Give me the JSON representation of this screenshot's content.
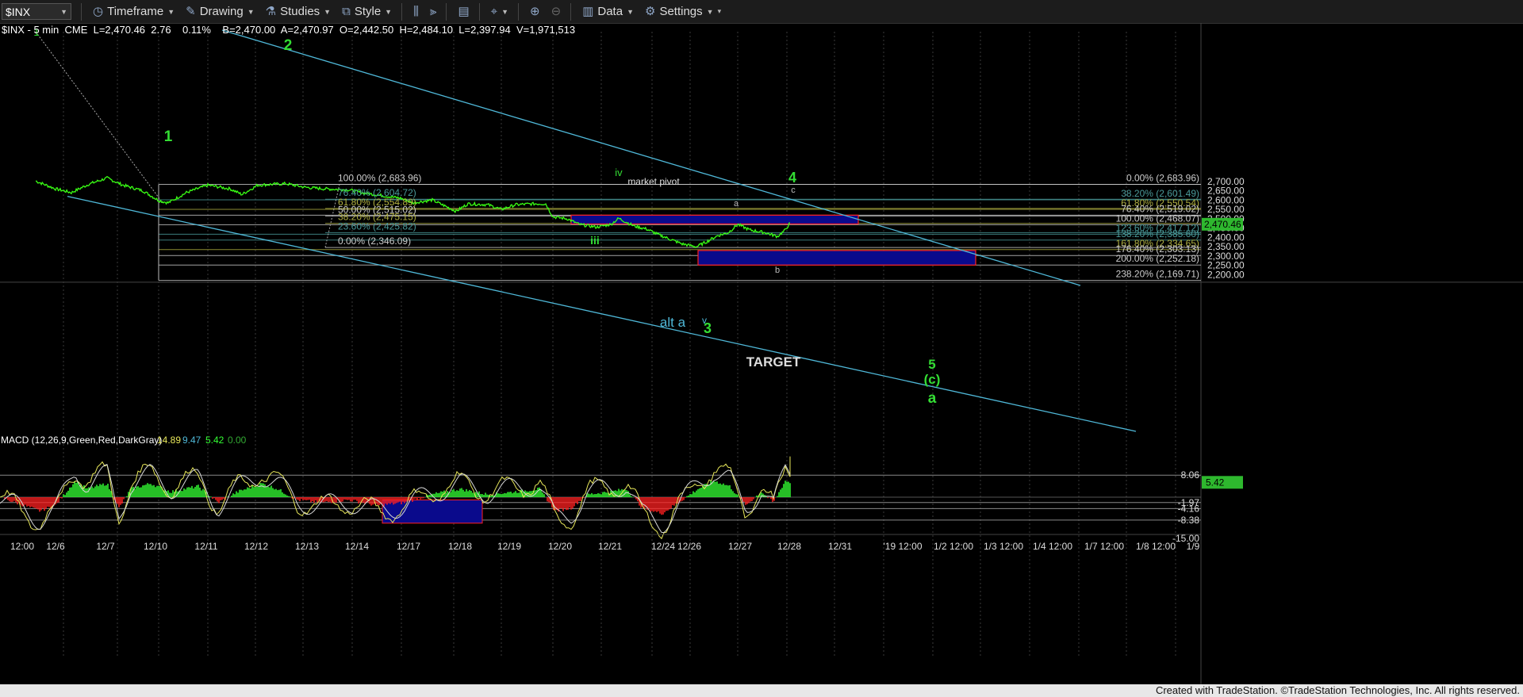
{
  "toolbar": {
    "symbol": "$INX",
    "timeframe": "Timeframe",
    "drawing": "Drawing",
    "studies": "Studies",
    "style": "Style",
    "data": "Data",
    "settings": "Settings"
  },
  "info": {
    "name": "$INX - 5 min",
    "exchange": "CME",
    "last": "L=2,470.46",
    "change": "2.76",
    "pct": "0.11%",
    "bid": "B=2,470.00",
    "ask": "A=2,470.97",
    "open": "O=2,442.50",
    "high": "H=2,484.10",
    "low": "L=2,397.94",
    "volume": "V=1,971,513"
  },
  "colors": {
    "price": "#39ff14",
    "channel": "#4fb8d8",
    "fibs": "#cccccc",
    "box": "#0a0a8c",
    "box_border": "#ff2020",
    "wave": "#33dd33"
  },
  "price_axis": {
    "ticks": [
      "2,700.00",
      "2,650.00",
      "2,600.00",
      "2,550.00",
      "2,500.00",
      "2,450.00",
      "2,400.00",
      "2,350.00",
      "2,300.00",
      "2,250.00",
      "2,200.00"
    ],
    "current": "2,470.46"
  },
  "macd": {
    "label": "MACD (12,26,9,Green,Red,DarkGray)",
    "v1": "14.89",
    "v2": "9.47",
    "v3": "5.42",
    "v4": "0.00",
    "ticks": [
      "8.06",
      "5.42",
      "-1.97",
      "-4.16",
      "-8.38",
      "-15.00"
    ]
  },
  "time_axis": [
    "12:00",
    "12/6",
    "12/7",
    "12/10",
    "12/11",
    "12/12",
    "12/13",
    "12/14",
    "12/17",
    "12/18",
    "12/19",
    "12/20",
    "12/21",
    "12/24",
    "12/26",
    "12/27",
    "12/28",
    "12/31",
    "'19 12:00",
    "1/2 12:00",
    "1/3 12:00",
    "1/4 12:00",
    "1/7 12:00",
    "1/8 12:00",
    "1/9"
  ],
  "fib_left": [
    "100.00% (2,683.96)",
    "76.40% (2,604.72)",
    "61.80% (2,554.89)",
    "50.00% (2,515.02)",
    "38.20% (2,475.15)",
    "23.60% (2,425.82)",
    "0.00% (2,346.09)"
  ],
  "fib_right": [
    "0.00% (2,683.96)",
    "38.20% (2,601.49)",
    "61.80% (2,550.54)",
    "76.40% (2,519.02)",
    "100.00% (2,468.07)",
    "123.60% (2,417.12)",
    "138.20% (2,385.60)",
    "161.80% (2,334.65)",
    "176.40% (2,303.13)",
    "200.00% (2,252.18)",
    "238.20% (2,169.71)"
  ],
  "labels": {
    "w1": "1",
    "w2": "2",
    "w1small": "1",
    "iii": "iii",
    "iv": "iv",
    "v": "v",
    "w3": "3",
    "w4": "4",
    "c": "c",
    "a": "a",
    "b": "b",
    "w5": "5",
    "c_paren": "(c)",
    "a_big": "a",
    "alt_a": "alt a",
    "market_pivot": "market pivot",
    "target": "TARGET"
  },
  "footer": "Created with TradeStation. ©TradeStation Technologies, Inc. All rights reserved.",
  "chart_data": {
    "type": "line",
    "title": "$INX - 5 min",
    "xlabel": "",
    "ylabel": "",
    "ylim": [
      2160,
      2720
    ],
    "x": [
      "12/5 12:00",
      "12/6",
      "12/7",
      "12/10",
      "12/11",
      "12/12",
      "12/13",
      "12/14",
      "12/17",
      "12/18",
      "12/19",
      "12/20",
      "12/21",
      "12/24",
      "12/26",
      "12/27",
      "12/28"
    ],
    "series": [
      {
        "values": [
          2702,
          2650,
          2705,
          2590,
          2670,
          2690,
          2650,
          2620,
          2560,
          2580,
          2555,
          2510,
          2488,
          2375,
          2351,
          2440,
          2470
        ]
      }
    ],
    "macd": {
      "ylim": [
        -17,
        15
      ],
      "hist_approx": [
        0,
        -3,
        6,
        -2,
        4,
        5,
        -1,
        -2,
        -3,
        1,
        2,
        -6,
        3,
        -8,
        -2,
        6,
        5.42
      ]
    }
  }
}
